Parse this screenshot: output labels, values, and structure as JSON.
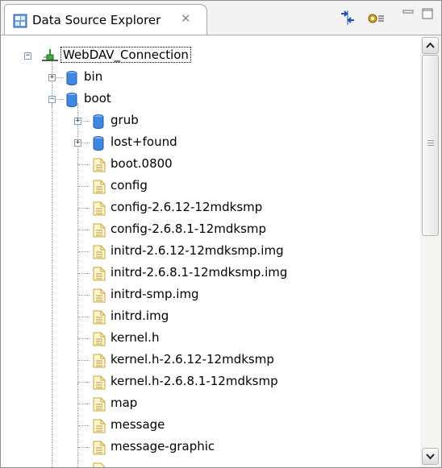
{
  "view": {
    "title": "Data Source Explorer",
    "close_glyph": "✕",
    "toolbar": [
      {
        "name": "collapse-all-icon"
      },
      {
        "name": "view-menu-icon"
      },
      {
        "name": "minimize-icon"
      },
      {
        "name": "maximize-icon"
      }
    ]
  },
  "tree": {
    "root": {
      "label": "WebDAV_Connection",
      "icon": "connection-icon",
      "expanded": true,
      "selected": true
    },
    "items": [
      {
        "label": "bin",
        "icon": "folder-icon",
        "expanded": false
      },
      {
        "label": "boot",
        "icon": "folder-icon",
        "expanded": true
      },
      {
        "label": "grub",
        "icon": "folder-icon",
        "expanded": false
      },
      {
        "label": "lost+found",
        "icon": "folder-icon",
        "expanded": false
      },
      {
        "label": "boot.0800",
        "icon": "file-icon"
      },
      {
        "label": "config",
        "icon": "file-icon"
      },
      {
        "label": "config-2.6.12-12mdksmp",
        "icon": "file-icon"
      },
      {
        "label": "config-2.6.8.1-12mdksmp",
        "icon": "file-icon"
      },
      {
        "label": "initrd-2.6.12-12mdksmp.img",
        "icon": "file-icon"
      },
      {
        "label": "initrd-2.6.8.1-12mdksmp.img",
        "icon": "file-icon"
      },
      {
        "label": "initrd-smp.img",
        "icon": "file-icon"
      },
      {
        "label": "initrd.img",
        "icon": "file-icon"
      },
      {
        "label": "kernel.h",
        "icon": "file-icon"
      },
      {
        "label": "kernel.h-2.6.12-12mdksmp",
        "icon": "file-icon"
      },
      {
        "label": "kernel.h-2.6.8.1-12mdksmp",
        "icon": "file-icon"
      },
      {
        "label": "map",
        "icon": "file-icon"
      },
      {
        "label": "message",
        "icon": "file-icon"
      },
      {
        "label": "message-graphic",
        "icon": "file-icon"
      }
    ]
  },
  "colors": {
    "folder": "#2f7ad6",
    "file_border": "#c9a43a",
    "file_fill": "#fff6cf",
    "connector": "#2a9a2a"
  }
}
